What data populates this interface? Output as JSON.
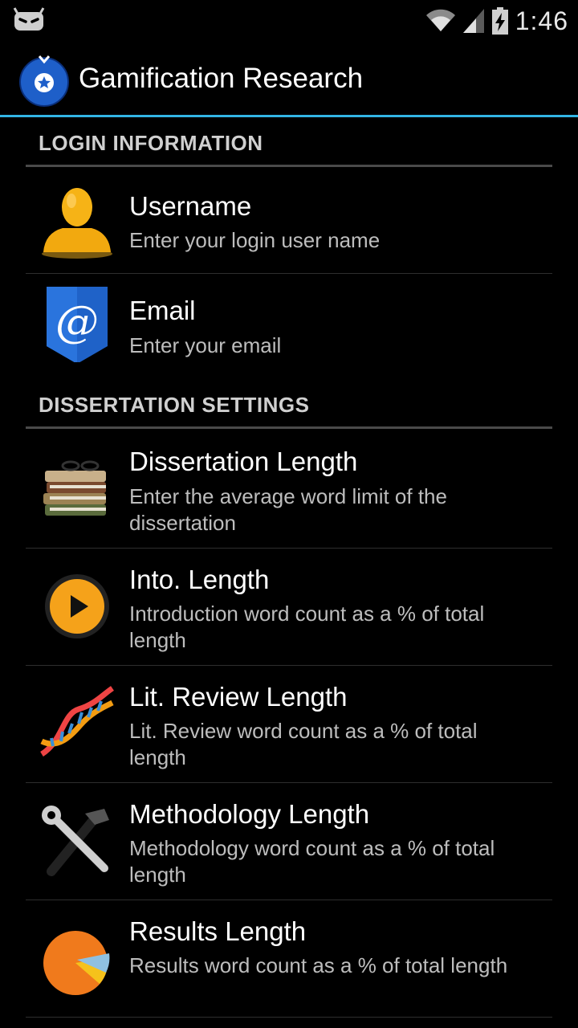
{
  "status_bar": {
    "time": "1:46",
    "icons": [
      "cyanogen-bot-icon",
      "wifi-icon",
      "signal-icon",
      "battery-charging-icon"
    ]
  },
  "action_bar": {
    "title": "Gamification Research",
    "icon": "app-star-badge-icon",
    "accent_color": "#33b5e5"
  },
  "sections": [
    {
      "title": "LOGIN INFORMATION",
      "items": [
        {
          "title": "Username",
          "summary": "Enter your login user name",
          "icon": "user-icon"
        },
        {
          "title": "Email",
          "summary": "Enter your email",
          "icon": "email-at-icon"
        }
      ]
    },
    {
      "title": "DISSERTATION SETTINGS",
      "items": [
        {
          "title": "Dissertation Length",
          "summary": "Enter the average word limit of the dissertation",
          "icon": "books-icon"
        },
        {
          "title": "Into. Length",
          "summary": "Introduction word count as a % of total length",
          "icon": "play-icon"
        },
        {
          "title": "Lit. Review Length",
          "summary": "Lit. Review word count as a % of total length",
          "icon": "dna-icon"
        },
        {
          "title": "Methodology Length",
          "summary": "Methodology word count as a % of total length",
          "icon": "tools-icon"
        },
        {
          "title": "Results Length",
          "summary": "Results word count as a % of total length",
          "icon": "pie-chart-icon"
        }
      ]
    }
  ]
}
